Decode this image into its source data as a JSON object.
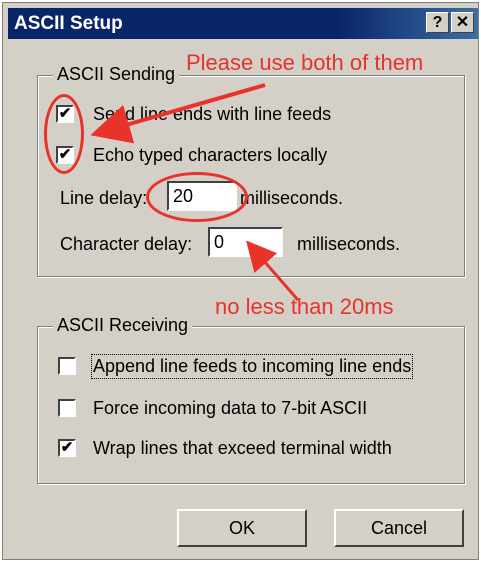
{
  "window": {
    "title": "ASCII Setup",
    "help_glyph": "?",
    "close_glyph": "✕",
    "titlebar_color": "#0a246a"
  },
  "sending": {
    "legend": "ASCII Sending",
    "send_line_ends": {
      "label": "Send line ends with line feeds",
      "checked": true
    },
    "echo_local": {
      "label": "Echo typed characters locally",
      "checked": true
    },
    "line_delay": {
      "label": "Line delay:",
      "value": "20",
      "unit": "milliseconds."
    },
    "char_delay": {
      "label": "Character delay:",
      "value": "0",
      "unit": "milliseconds."
    }
  },
  "receiving": {
    "legend": "ASCII Receiving",
    "append_lf": {
      "label": "Append line feeds to incoming line ends",
      "checked": false
    },
    "force_7bit": {
      "label": "Force incoming data to 7-bit ASCII",
      "checked": false
    },
    "wrap_lines": {
      "label": "Wrap lines that exceed terminal width",
      "checked": true
    }
  },
  "buttons": {
    "ok": "OK",
    "cancel": "Cancel"
  },
  "annotations": {
    "top": "Please use both of them",
    "bottom": "no less than 20ms",
    "color": "#e8322a"
  },
  "check_glyph": "✔"
}
